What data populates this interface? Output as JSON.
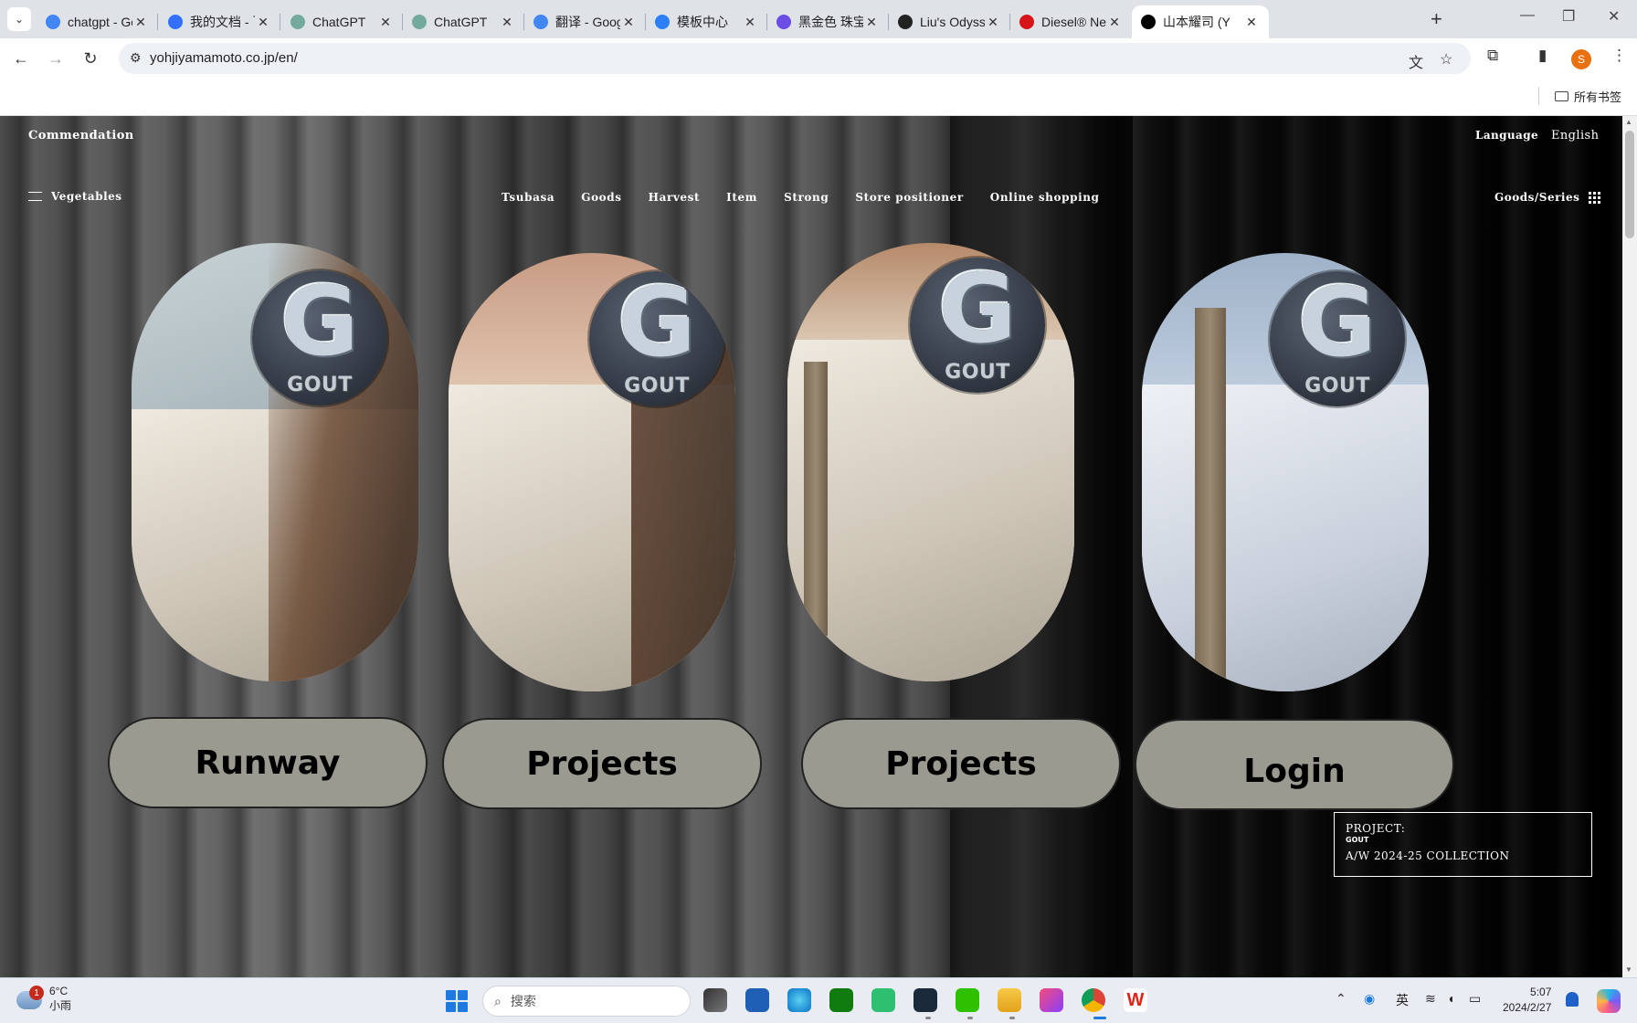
{
  "browser": {
    "tabs": [
      {
        "title": "chatgpt - Go",
        "favicon": "google-icon",
        "color": "#4285f4"
      },
      {
        "title": "我的文档 - 飞",
        "favicon": "feishu-doc-icon",
        "color": "#3370ff"
      },
      {
        "title": "ChatGPT",
        "favicon": "chatgpt-icon",
        "color": "#74aa9c"
      },
      {
        "title": "ChatGPT",
        "favicon": "chatgpt-icon",
        "color": "#74aa9c"
      },
      {
        "title": "翻译 - Googl",
        "favicon": "google-icon",
        "color": "#4285f4"
      },
      {
        "title": "模板中心",
        "favicon": "canva-icon",
        "color": "#2d7ff9"
      },
      {
        "title": "黑金色 珠宝",
        "favicon": "calendar-icon",
        "color": "#6b4de6"
      },
      {
        "title": "Liu's Odysse",
        "favicon": "c-icon",
        "color": "#222222"
      },
      {
        "title": "Diesel® Nev",
        "favicon": "diesel-icon",
        "color": "#d7141a"
      },
      {
        "title": "山本耀司 (Y",
        "favicon": "y-icon",
        "color": "#000000",
        "active": true
      }
    ],
    "url": "yohjiyamamoto.co.jp/en/",
    "profile_initial": "S",
    "bookmarks_folder": "所有书签"
  },
  "site": {
    "top_left": "Commendation",
    "language_label": "Language",
    "language_value": "English",
    "menu_label": "Vegetables",
    "nav": [
      "Tsubasa",
      "Goods",
      "Harvest",
      "Item",
      "Strong",
      "Store positioner",
      "Online shopping"
    ],
    "goods_series": "Goods/Series",
    "logo_letter": "G",
    "logo_word": "GOUT",
    "buttons": [
      "Runway",
      "Projects",
      "Projects",
      "Login"
    ],
    "project": {
      "label": "PROJECT:",
      "brand": "GOUT",
      "collection": "A/W 2024-25 COLLECTION"
    }
  },
  "taskbar": {
    "weather_temp": "6°C",
    "weather_desc": "小雨",
    "weather_badge": "1",
    "search_placeholder": "搜索",
    "ime": "英",
    "time": "5:07",
    "date": "2024/2/27"
  }
}
